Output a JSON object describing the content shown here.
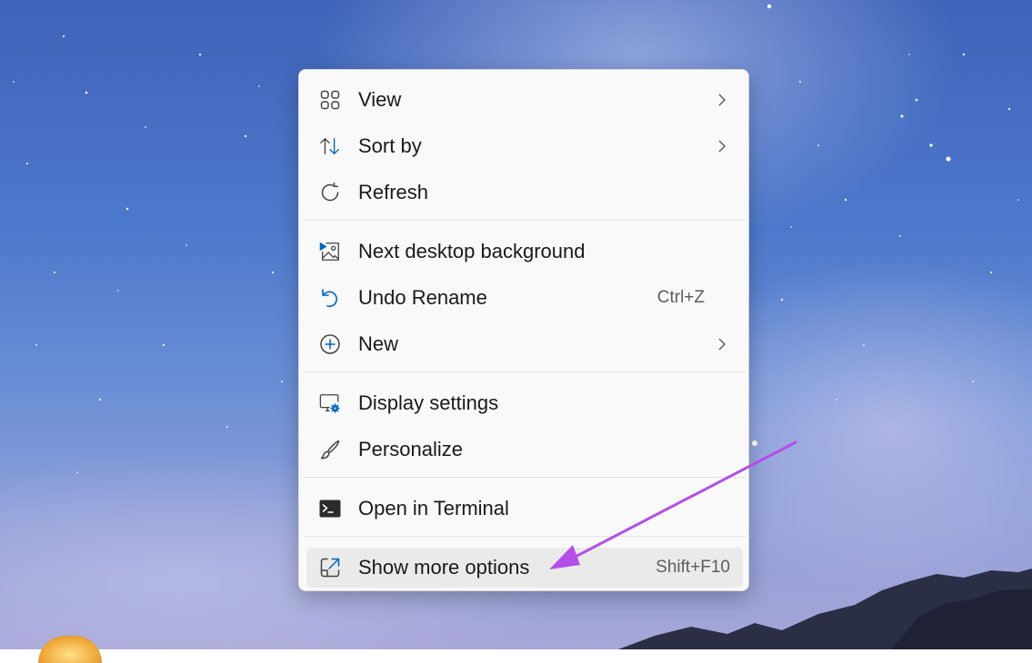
{
  "menu": {
    "items": [
      {
        "label": "View",
        "icon": "grid-icon",
        "has_submenu": true
      },
      {
        "label": "Sort by",
        "icon": "sort-arrows-icon",
        "has_submenu": true
      },
      {
        "label": "Refresh",
        "icon": "refresh-icon"
      },
      {
        "label": "Next desktop background",
        "icon": "next-background-icon"
      },
      {
        "label": "Undo Rename",
        "icon": "undo-icon",
        "shortcut": "Ctrl+Z"
      },
      {
        "label": "New",
        "icon": "plus-circle-icon",
        "has_submenu": true
      },
      {
        "label": "Display settings",
        "icon": "display-settings-icon"
      },
      {
        "label": "Personalize",
        "icon": "paintbrush-icon"
      },
      {
        "label": "Open in Terminal",
        "icon": "terminal-icon"
      },
      {
        "label": "Show more options",
        "icon": "external-options-icon",
        "shortcut": "Shift+F10"
      }
    ]
  },
  "colors": {
    "accent": "#0067c0",
    "annotation_arrow": "#b34ee8",
    "menu_background": "#f9f9f9",
    "hover_background": "#eaeaea"
  }
}
